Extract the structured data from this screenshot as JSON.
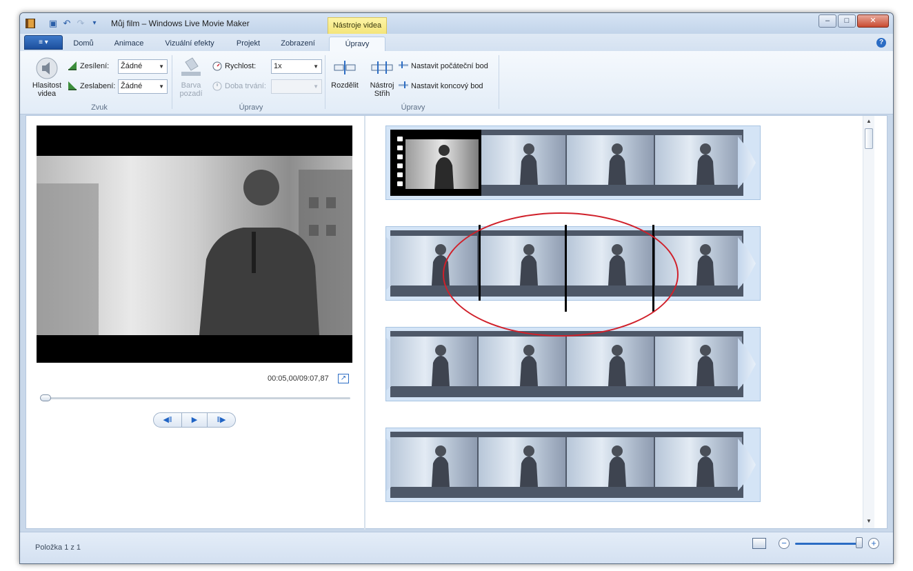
{
  "window": {
    "title": "Můj film – Windows Live Movie Maker",
    "context_tab": "Nástroje videa",
    "controls": {
      "minimize": "–",
      "maximize": "□",
      "close": "✕"
    }
  },
  "quick_access": {
    "save": "save-icon",
    "undo": "undo-icon",
    "redo": "redo-icon",
    "customize": "▾"
  },
  "tabs": {
    "file_menu": "≡ ▾",
    "items": [
      "Domů",
      "Animace",
      "Vizuální efekty",
      "Projekt",
      "Zobrazení",
      "Úpravy"
    ],
    "active": "Úpravy",
    "help": "?"
  },
  "ribbon": {
    "sound": {
      "label": "Zvuk",
      "video_volume": "Hlasitost videa",
      "volume_line1": "Hlasitost",
      "volume_line2": "videa",
      "fade_in_label": "Zesílení:",
      "fade_in_value": "Žádné",
      "fade_out_label": "Zeslabení:",
      "fade_out_value": "Žádné"
    },
    "adjust": {
      "label": "Úpravy",
      "bg_color_line1": "Barva",
      "bg_color_line2": "pozadí",
      "speed_label": "Rychlost:",
      "speed_value": "1x",
      "duration_label": "Doba trvání:",
      "duration_value": ""
    },
    "edit": {
      "label": "Úpravy",
      "split": "Rozdělit",
      "trim_line1": "Nástroj",
      "trim_line2": "Střih",
      "set_start": "Nastavit počáteční bod",
      "set_end": "Nastavit koncový bod"
    }
  },
  "preview": {
    "timecode": "00:05,00/09:07,87",
    "seek_position": 0.01,
    "buttons": {
      "prev": "◀‖",
      "play": "▶",
      "next": "‖▶"
    }
  },
  "storyboard": {
    "strip_count": 4,
    "frames_per_strip": 4
  },
  "status": {
    "item_text": "Položka 1 z 1",
    "zoom_minus": "−",
    "zoom_plus": "+",
    "zoom_level": 0.95
  },
  "colors": {
    "accent": "#2b6cc4",
    "annotation": "#d0202a",
    "context_tab": "#f4e57a"
  }
}
